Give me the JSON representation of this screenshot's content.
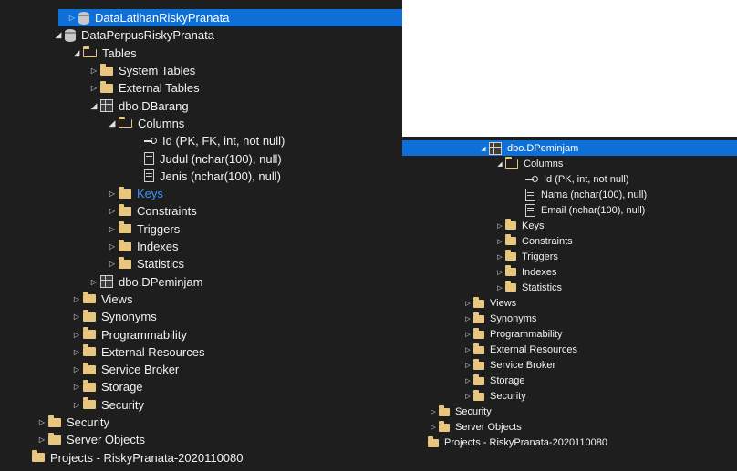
{
  "left_tree": {
    "items": [
      {
        "label": "DataLatihanRiskyPranata",
        "icon": "database-icon",
        "arrow": "collapsed",
        "selected": true
      },
      {
        "label": "DataPerpusRiskyPranata",
        "icon": "database-icon",
        "arrow": "expanded"
      },
      {
        "label": "Tables",
        "icon": "folder-open-icon",
        "arrow": "expanded"
      },
      {
        "label": "System Tables",
        "icon": "folder-icon",
        "arrow": "collapsed"
      },
      {
        "label": "External Tables",
        "icon": "folder-icon",
        "arrow": "collapsed"
      },
      {
        "label": "dbo.DBarang",
        "icon": "table-icon",
        "arrow": "expanded"
      },
      {
        "label": "Columns",
        "icon": "folder-open-icon",
        "arrow": "expanded"
      },
      {
        "label": "Id (PK, FK, int, not null)",
        "icon": "key-icon",
        "arrow": "none"
      },
      {
        "label": "Judul (nchar(100), null)",
        "icon": "column-icon",
        "arrow": "none"
      },
      {
        "label": "Jenis (nchar(100), null)",
        "icon": "column-icon",
        "arrow": "none"
      },
      {
        "label": "Keys",
        "icon": "folder-icon",
        "arrow": "collapsed",
        "highlight": true
      },
      {
        "label": "Constraints",
        "icon": "folder-icon",
        "arrow": "collapsed"
      },
      {
        "label": "Triggers",
        "icon": "folder-icon",
        "arrow": "collapsed"
      },
      {
        "label": "Indexes",
        "icon": "folder-icon",
        "arrow": "collapsed"
      },
      {
        "label": "Statistics",
        "icon": "folder-icon",
        "arrow": "collapsed"
      },
      {
        "label": "dbo.DPeminjam",
        "icon": "table-icon",
        "arrow": "collapsed"
      },
      {
        "label": "Views",
        "icon": "folder-icon",
        "arrow": "collapsed"
      },
      {
        "label": "Synonyms",
        "icon": "folder-icon",
        "arrow": "collapsed"
      },
      {
        "label": "Programmability",
        "icon": "folder-icon",
        "arrow": "collapsed"
      },
      {
        "label": "External Resources",
        "icon": "folder-icon",
        "arrow": "collapsed"
      },
      {
        "label": "Service Broker",
        "icon": "folder-icon",
        "arrow": "collapsed"
      },
      {
        "label": "Storage",
        "icon": "folder-icon",
        "arrow": "collapsed"
      },
      {
        "label": "Security",
        "icon": "folder-icon",
        "arrow": "collapsed"
      },
      {
        "label": "Security",
        "icon": "folder-icon",
        "arrow": "collapsed"
      },
      {
        "label": "Server Objects",
        "icon": "folder-icon",
        "arrow": "collapsed"
      },
      {
        "label": "Projects - RiskyPranata-2020110080",
        "icon": "folder-icon",
        "arrow": "none"
      }
    ]
  },
  "right_tree": {
    "items": [
      {
        "label": "dbo.DPeminjam",
        "icon": "table-icon",
        "arrow": "expanded",
        "selected": true
      },
      {
        "label": "Columns",
        "icon": "folder-open-icon",
        "arrow": "expanded"
      },
      {
        "label": "Id (PK, int, not null)",
        "icon": "key-icon",
        "arrow": "none"
      },
      {
        "label": "Nama (nchar(100), null)",
        "icon": "column-icon",
        "arrow": "none"
      },
      {
        "label": "Email (nchar(100), null)",
        "icon": "column-icon",
        "arrow": "none"
      },
      {
        "label": "Keys",
        "icon": "folder-icon",
        "arrow": "collapsed"
      },
      {
        "label": "Constraints",
        "icon": "folder-icon",
        "arrow": "collapsed"
      },
      {
        "label": "Triggers",
        "icon": "folder-icon",
        "arrow": "collapsed"
      },
      {
        "label": "Indexes",
        "icon": "folder-icon",
        "arrow": "collapsed"
      },
      {
        "label": "Statistics",
        "icon": "folder-icon",
        "arrow": "collapsed"
      },
      {
        "label": "Views",
        "icon": "folder-icon",
        "arrow": "collapsed"
      },
      {
        "label": "Synonyms",
        "icon": "folder-icon",
        "arrow": "collapsed"
      },
      {
        "label": "Programmability",
        "icon": "folder-icon",
        "arrow": "collapsed"
      },
      {
        "label": "External Resources",
        "icon": "folder-icon",
        "arrow": "collapsed"
      },
      {
        "label": "Service Broker",
        "icon": "folder-icon",
        "arrow": "collapsed"
      },
      {
        "label": "Storage",
        "icon": "folder-icon",
        "arrow": "collapsed"
      },
      {
        "label": "Security",
        "icon": "folder-icon",
        "arrow": "collapsed"
      },
      {
        "label": "Security",
        "icon": "folder-icon",
        "arrow": "collapsed"
      },
      {
        "label": "Server Objects",
        "icon": "folder-icon",
        "arrow": "collapsed"
      },
      {
        "label": "Projects - RiskyPranata-2020110080",
        "icon": "folder-icon",
        "arrow": "none"
      }
    ]
  },
  "colors": {
    "background": "#1e1e1e",
    "selection": "#0e6fd6",
    "highlight_text": "#3794ff",
    "folder": "#e8c680"
  }
}
